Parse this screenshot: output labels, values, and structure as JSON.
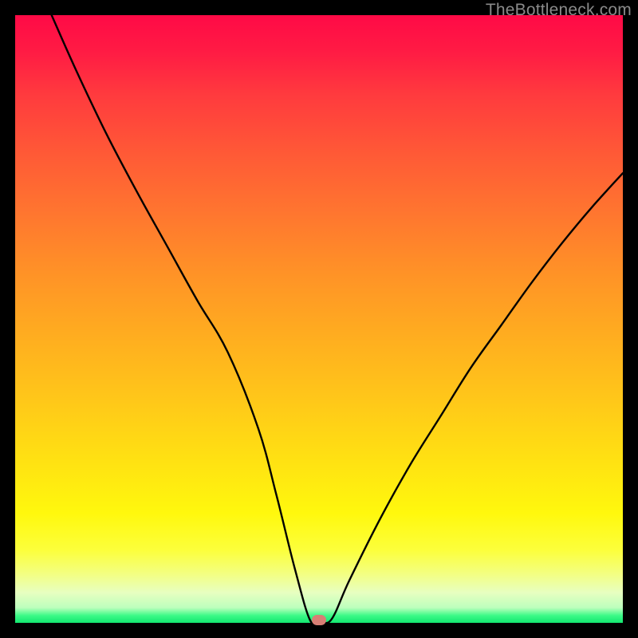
{
  "watermark": "TheBottleneck.com",
  "chart_data": {
    "type": "line",
    "title": "",
    "xlabel": "",
    "ylabel": "",
    "xlim": [
      0,
      100
    ],
    "ylim": [
      0,
      100
    ],
    "x": [
      6,
      10,
      15,
      20,
      25,
      30,
      35,
      40,
      43,
      46,
      48.5,
      50,
      52,
      55,
      60,
      65,
      70,
      75,
      80,
      85,
      90,
      95,
      100
    ],
    "values": [
      100,
      91,
      80.5,
      71,
      62,
      53,
      44.5,
      32,
      21,
      9,
      0.5,
      0.5,
      0.5,
      7,
      17,
      26,
      34,
      42,
      49,
      56,
      62.5,
      68.5,
      74
    ],
    "marker": {
      "x": 50,
      "y": 0.5
    },
    "gradient": {
      "direction": "vertical",
      "stops": [
        {
          "pct": 0,
          "color": "#ff0a46"
        },
        {
          "pct": 50,
          "color": "#ffab20"
        },
        {
          "pct": 85,
          "color": "#fff80d"
        },
        {
          "pct": 100,
          "color": "#13e770"
        }
      ]
    }
  }
}
